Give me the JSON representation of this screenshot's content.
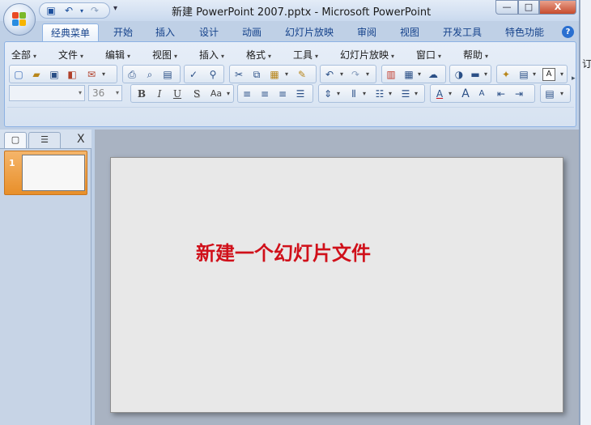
{
  "window": {
    "title": "新建 PowerPoint 2007.pptx - Microsoft PowerPoint",
    "controls": {
      "minimize": "—",
      "maximize": "□",
      "close": "X"
    }
  },
  "quick_access": {
    "icons": [
      "save-icon",
      "undo-icon",
      "redo-icon"
    ],
    "undo_glyph": "↶",
    "redo_glyph": "↷",
    "save_glyph": "▣",
    "more_glyph": "▾"
  },
  "tabs": [
    {
      "label": "经典菜单",
      "active": true
    },
    {
      "label": "开始"
    },
    {
      "label": "插入"
    },
    {
      "label": "设计"
    },
    {
      "label": "动画"
    },
    {
      "label": "幻灯片放映"
    },
    {
      "label": "审阅"
    },
    {
      "label": "视图"
    },
    {
      "label": "开发工具"
    },
    {
      "label": "特色功能"
    }
  ],
  "help_glyph": "?",
  "menus": [
    {
      "label": "全部"
    },
    {
      "label": "文件"
    },
    {
      "label": "编辑"
    },
    {
      "label": "视图"
    },
    {
      "label": "插入"
    },
    {
      "label": "格式"
    },
    {
      "label": "工具"
    },
    {
      "label": "幻灯片放映"
    },
    {
      "label": "窗口"
    },
    {
      "label": "帮助"
    }
  ],
  "font_combo": {
    "name": "",
    "size": "36"
  },
  "toolbar_glyphs": {
    "bold": "B",
    "italic": "I",
    "underline": "U",
    "shadow": "S",
    "case": "Aa"
  },
  "left_pane": {
    "close_glyph": "X",
    "slide_number": "1"
  },
  "slide": {
    "text": "新建一个幻灯片文件",
    "text_color": "#d0101a"
  },
  "right_edge_glyph": "订"
}
